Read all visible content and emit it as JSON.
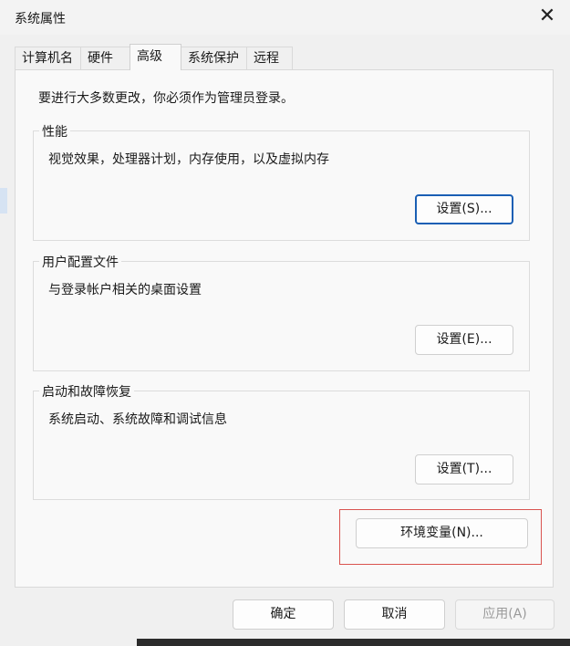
{
  "window": {
    "title": "系统属性",
    "close_icon": "close-icon"
  },
  "tabs": [
    {
      "label": "计算机名",
      "active": false
    },
    {
      "label": "硬件",
      "active": false
    },
    {
      "label": "高级",
      "active": true
    },
    {
      "label": "系统保护",
      "active": false
    },
    {
      "label": "远程",
      "active": false
    }
  ],
  "intro": "要进行大多数更改，你必须作为管理员登录。",
  "groups": {
    "performance": {
      "title": "性能",
      "desc": "视觉效果，处理器计划，内存使用，以及虚拟内存",
      "button": "设置(S)..."
    },
    "profile": {
      "title": "用户配置文件",
      "desc": "与登录帐户相关的桌面设置",
      "button": "设置(E)..."
    },
    "startup": {
      "title": "启动和故障恢复",
      "desc": "系统启动、系统故障和调试信息",
      "button": "设置(T)..."
    }
  },
  "env_button": "环境变量(N)...",
  "footer": {
    "ok": "确定",
    "cancel": "取消",
    "apply": "应用(A)"
  },
  "colors": {
    "accent": "#1a5fb4",
    "highlight_border": "#d9534f"
  }
}
